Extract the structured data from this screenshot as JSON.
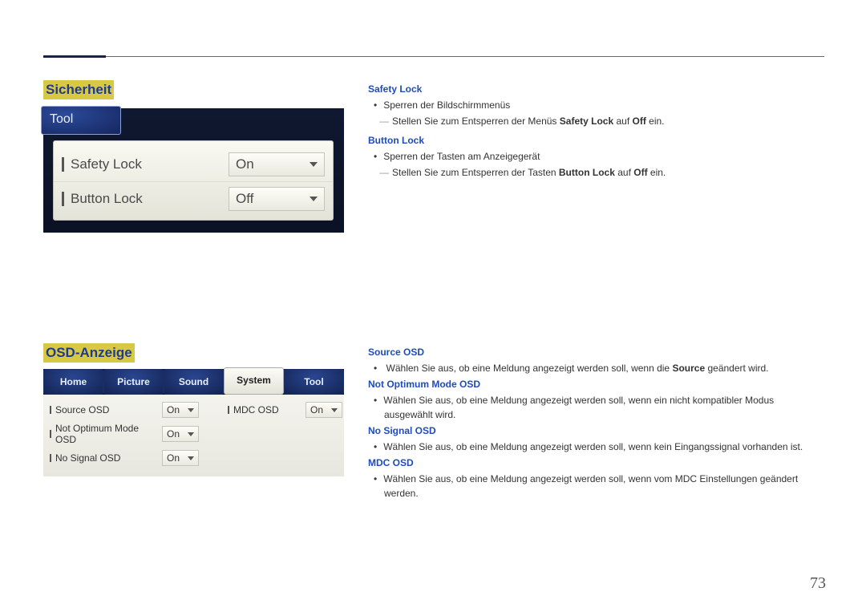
{
  "section1": {
    "title": "Sicherheit",
    "osd_tab": "Tool",
    "rows": [
      {
        "label": "Safety Lock",
        "value": "On"
      },
      {
        "label": "Button Lock",
        "value": "Off"
      }
    ],
    "right": {
      "h1": "Safety Lock",
      "b1": "Sperren der Bildschirmmenüs",
      "n1_pre": "Stellen Sie zum Entsperren der Menüs ",
      "n1_bold1": "Safety Lock",
      "n1_mid": " auf ",
      "n1_bold2": "Off",
      "n1_post": " ein.",
      "h2": "Button Lock",
      "b2": "Sperren der Tasten am Anzeigegerät",
      "n2_pre": "Stellen Sie zum Entsperren der Tasten ",
      "n2_bold1": "Button Lock",
      "n2_mid": " auf ",
      "n2_bold2": "Off",
      "n2_post": " ein."
    }
  },
  "section2": {
    "title": "OSD-Anzeige",
    "tabs": [
      "Home",
      "Picture",
      "Sound",
      "System",
      "Tool"
    ],
    "active_tab_index": 3,
    "left_rows": [
      {
        "label": "Source OSD",
        "value": "On"
      },
      {
        "label": "Not Optimum Mode OSD",
        "value": "On"
      },
      {
        "label": "No Signal OSD",
        "value": "On"
      }
    ],
    "right_rows": [
      {
        "label": "MDC OSD",
        "value": "On"
      }
    ],
    "right_text": {
      "h1": "Source OSD",
      "b1_pre": "Wählen Sie aus, ob eine Meldung angezeigt werden soll, wenn die ",
      "b1_bold": "Source",
      "b1_post": " geändert wird.",
      "h2": "Not Optimum Mode OSD",
      "b2": "Wählen Sie aus, ob eine Meldung angezeigt werden soll, wenn ein nicht kompatibler Modus ausgewählt wird.",
      "h3": "No Signal OSD",
      "b3": "Wählen Sie aus, ob eine Meldung angezeigt werden soll, wenn kein Eingangssignal vorhanden ist.",
      "h4": "MDC OSD",
      "b4": "Wählen Sie aus, ob eine Meldung angezeigt werden soll, wenn vom MDC Einstellungen geändert werden."
    }
  },
  "page_number": "73"
}
